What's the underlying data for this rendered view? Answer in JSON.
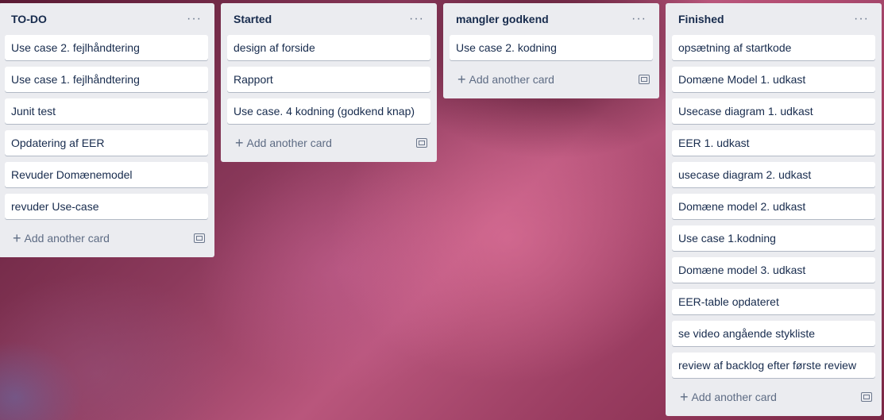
{
  "lists": [
    {
      "title": "TO-DO",
      "menu": "···",
      "cards": [
        "Use case 2. fejlhåndtering",
        "Use case 1. fejlhåndtering",
        "Junit test",
        "Opdatering af EER",
        "Revuder Domænemodel",
        "revuder Use-case"
      ],
      "add_label": "Add another card"
    },
    {
      "title": "Started",
      "menu": "···",
      "cards": [
        "design af forside",
        "Rapport",
        "Use case. 4 kodning (godkend knap)"
      ],
      "add_label": "Add another card"
    },
    {
      "title": "mangler godkend",
      "menu": "···",
      "cards": [
        "Use case 2. kodning"
      ],
      "add_label": "Add another card"
    },
    {
      "title": "Finished",
      "menu": "···",
      "cards": [
        "opsætning af startkode",
        "Domæne Model 1. udkast",
        "Usecase diagram 1. udkast",
        "EER 1. udkast",
        "usecase diagram 2. udkast",
        "Domæne model 2. udkast",
        "Use case 1.kodning",
        "Domæne model 3. udkast",
        "EER-table opdateret",
        "se video angående stykliste",
        "review af backlog efter første review"
      ],
      "add_label": "Add another card"
    }
  ],
  "icons": {
    "add": "plus-icon",
    "template": "card-template-icon",
    "menu": "ellipsis-icon"
  },
  "colors": {
    "list_bg": "#ebecf0",
    "card_bg": "#ffffff",
    "text": "#172b4d",
    "muted": "#5e6c84"
  }
}
